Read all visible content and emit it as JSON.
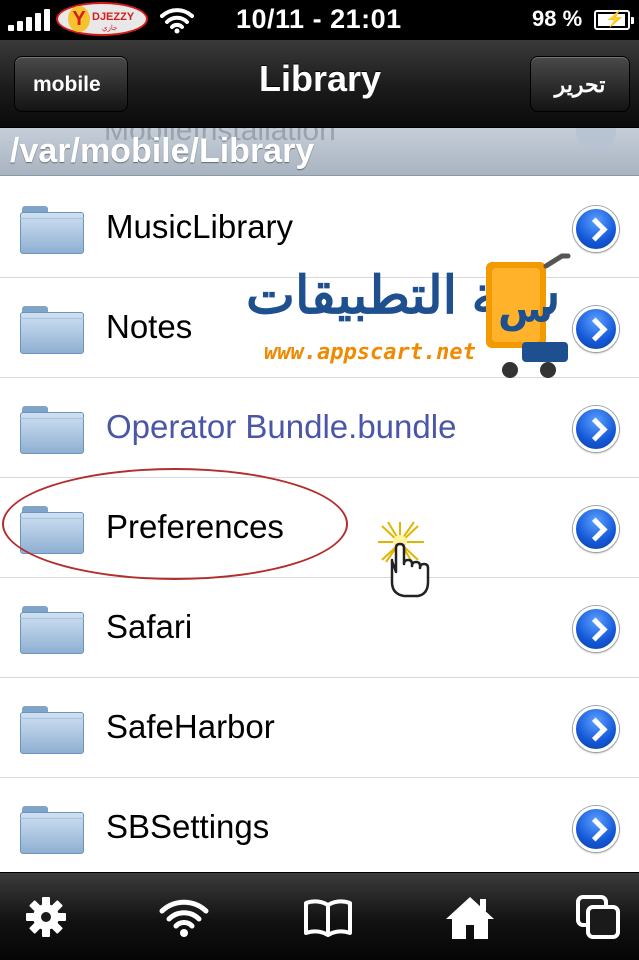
{
  "status_bar": {
    "carrier": "DJEZZY",
    "carrier_subtitle": "جازي",
    "time": "10/11 - 21:01",
    "battery_percent": "98 %",
    "battery_level": 0.98,
    "signal_bars": 5,
    "charging": true
  },
  "nav": {
    "back_label": "mobile",
    "title": "Library",
    "edit_label": "تحرير"
  },
  "path": {
    "current": "/var/mobile/Library",
    "ghost_text": "MobileInstallation"
  },
  "files": [
    {
      "name": "MusicLibrary",
      "icon": "folder-icon",
      "highlighted": false
    },
    {
      "name": "Notes",
      "icon": "folder-icon",
      "highlighted": false
    },
    {
      "name": "Operator Bundle.bundle",
      "icon": "folder-icon",
      "highlighted": false,
      "link_color": "#4a57a8"
    },
    {
      "name": "Preferences",
      "icon": "folder-icon",
      "highlighted": true
    },
    {
      "name": "Safari",
      "icon": "folder-icon",
      "highlighted": false
    },
    {
      "name": "SafeHarbor",
      "icon": "folder-icon",
      "highlighted": false
    },
    {
      "name": "SBSettings",
      "icon": "folder-icon",
      "highlighted": false
    }
  ],
  "watermark": {
    "arabic": "سلة التطبيقات",
    "url": "www.appscart.net"
  },
  "toolbar": {
    "items": [
      "gear-icon",
      "wifi-icon",
      "book-icon",
      "home-icon",
      "windows-icon"
    ]
  },
  "colors": {
    "disclosure_blue": "#1458d8",
    "highlight_red": "#b32d2d",
    "watermark_blue": "#1e4f8f",
    "watermark_orange": "#f08a00"
  }
}
